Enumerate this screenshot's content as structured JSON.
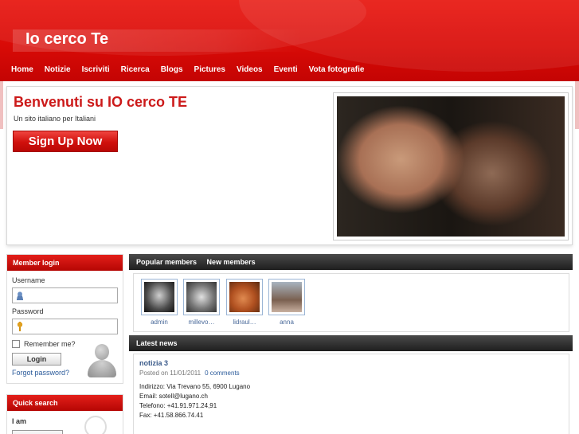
{
  "header": {
    "site_title": "Io cerco Te",
    "nav": [
      "Home",
      "Notizie",
      "Iscriviti",
      "Ricerca",
      "Blogs",
      "Pictures",
      "Videos",
      "Eventi",
      "Vota fotografie"
    ]
  },
  "hero": {
    "heading": "Benvenuti su IO cerco TE",
    "tagline": "Un sito italiano per Italiani",
    "signup_label": "Sign Up Now"
  },
  "login": {
    "title": "Member login",
    "username_label": "Username",
    "password_label": "Password",
    "remember_label": "Remember me?",
    "login_label": "Login",
    "forgot_label": "Forgot password?"
  },
  "quick_search": {
    "title": "Quick search",
    "iam_label": "I am"
  },
  "members_bar": {
    "tabs": [
      "Popular members",
      "New members"
    ]
  },
  "members": [
    "admin",
    "millevo…",
    "lidraul…",
    "anna"
  ],
  "news_bar": {
    "title": "Latest news"
  },
  "news": {
    "title": "notizia 3",
    "posted": "Posted on 11/01/2011",
    "comments": "0 comments",
    "lines": [
      "Indirizzo: Via Trevano 55, 6900 Lugano",
      "Email: sotell@lugano.ch",
      "Telefono: +41.91.971.24,91",
      "Fax: +41.58.866.74.41"
    ]
  },
  "colors": {
    "brand_red": "#d90b07",
    "heading_red": "#cc1a1a",
    "link_blue": "#2a5a9a"
  }
}
